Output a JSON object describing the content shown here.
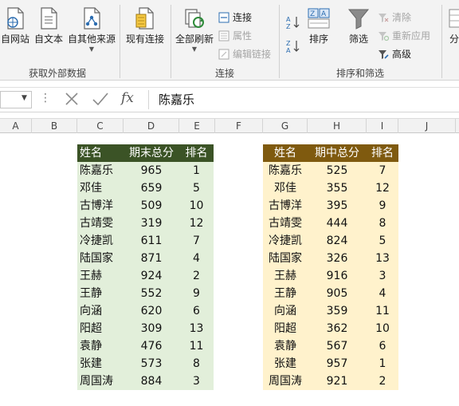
{
  "ribbon": {
    "get_external": {
      "buttons": [
        "自网站",
        "自文本",
        "自其他来源",
        "现有连接"
      ],
      "label": "获取外部数据"
    },
    "connections": {
      "refresh_all": "全部刷新",
      "items": [
        "连接",
        "属性",
        "编辑链接"
      ],
      "label": "连接"
    },
    "sort_filter": {
      "sort": "排序",
      "filter": "筛选",
      "items": [
        "清除",
        "重新应用",
        "高级"
      ],
      "label": "排序和筛选"
    },
    "partial_next": "分"
  },
  "formula_bar": {
    "name_box": "",
    "fx": "fx",
    "content": "陈嘉乐"
  },
  "columns": [
    "A",
    "B",
    "C",
    "D",
    "E",
    "F",
    "G",
    "H",
    "I",
    "J"
  ],
  "left_table": {
    "headers": [
      "姓名",
      "期末总分",
      "排名"
    ],
    "header_color": "#3b5326",
    "body_color": "#e2efda",
    "rows": [
      [
        "陈嘉乐",
        "965",
        "1"
      ],
      [
        "邓佳",
        "659",
        "5"
      ],
      [
        "古博洋",
        "509",
        "10"
      ],
      [
        "古靖雯",
        "319",
        "12"
      ],
      [
        "冷捷凯",
        "611",
        "7"
      ],
      [
        "陆国家",
        "871",
        "4"
      ],
      [
        "王赫",
        "924",
        "2"
      ],
      [
        "王静",
        "552",
        "9"
      ],
      [
        "向涵",
        "620",
        "6"
      ],
      [
        "阳超",
        "309",
        "13"
      ],
      [
        "袁静",
        "476",
        "11"
      ],
      [
        "张建",
        "573",
        "8"
      ],
      [
        "周国涛",
        "884",
        "3"
      ]
    ]
  },
  "right_table": {
    "headers": [
      "姓名",
      "期中总分",
      "排名"
    ],
    "header_color": "#7f5a0f",
    "body_color": "#fff2cc",
    "rows": [
      [
        "陈嘉乐",
        "525",
        "7"
      ],
      [
        "邓佳",
        "355",
        "12"
      ],
      [
        "古博洋",
        "395",
        "9"
      ],
      [
        "古靖雯",
        "444",
        "8"
      ],
      [
        "冷捷凯",
        "824",
        "5"
      ],
      [
        "陆国家",
        "326",
        "13"
      ],
      [
        "王赫",
        "916",
        "3"
      ],
      [
        "王静",
        "905",
        "4"
      ],
      [
        "向涵",
        "359",
        "11"
      ],
      [
        "阳超",
        "362",
        "10"
      ],
      [
        "袁静",
        "567",
        "6"
      ],
      [
        "张建",
        "957",
        "1"
      ],
      [
        "周国涛",
        "921",
        "2"
      ]
    ]
  }
}
